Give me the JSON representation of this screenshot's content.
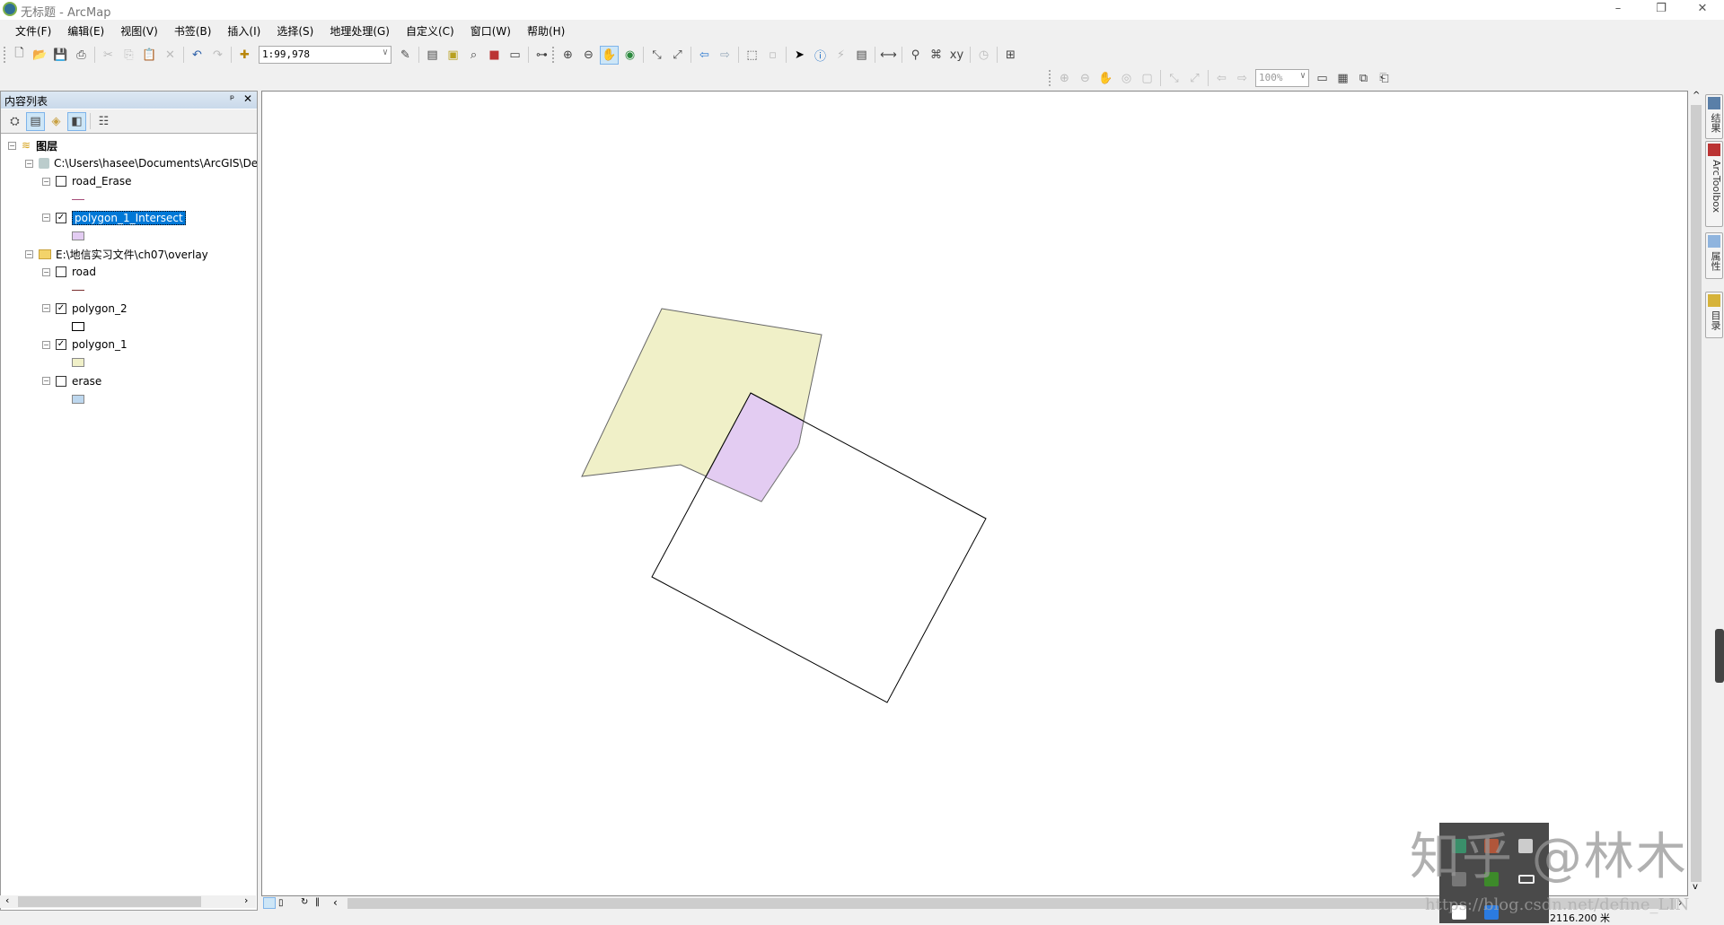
{
  "window": {
    "title": "无标题 - ArcMap",
    "minimize": "–",
    "restore": "❐",
    "close": "✕"
  },
  "menu": [
    "文件(F)",
    "编辑(E)",
    "视图(V)",
    "书签(B)",
    "插入(I)",
    "选择(S)",
    "地理处理(G)",
    "自定义(C)",
    "窗口(W)",
    "帮助(H)"
  ],
  "toolbar1": {
    "scale": "1:99,978",
    "group1": [
      "new-icon",
      "open-icon",
      "save-icon",
      "print-icon",
      "|",
      "cut-icon",
      "copy-icon",
      "paste-icon",
      "delete-icon",
      "|",
      "undo-icon",
      "redo-icon",
      "|",
      "add-data-icon"
    ],
    "group2": [
      "editor-icon",
      "|",
      "table-icon",
      "catalog-icon",
      "search-window-icon",
      "arctoolbox-icon",
      "python-icon",
      "|",
      "modelbuilder-icon",
      "grip",
      "zoom-in-icon",
      "zoom-out-icon",
      "pan-icon",
      "full-extent-icon",
      "|",
      "fixed-zoom-in-icon",
      "fixed-zoom-out-icon",
      "|",
      "back-icon",
      "forward-icon",
      "|",
      "select-features-icon",
      "clear-selection-icon",
      "|",
      "select-elements-icon",
      "identify-icon",
      "hyperlink-icon",
      "html-popup-icon",
      "|",
      "measure-icon",
      "|",
      "find-icon",
      "find-route-icon",
      "go-to-xy-icon",
      "|",
      "time-slider-icon",
      "|",
      "magnifier-icon"
    ]
  },
  "toolbar2": {
    "zoom": "100%",
    "icons": [
      "layout-zoom-in-icon",
      "layout-zoom-out-icon",
      "layout-pan-icon",
      "zoom-whole-page-icon",
      "zoom-100-icon",
      "|",
      "fixed-zoom-in-icon",
      "fixed-zoom-out-icon",
      "|",
      "back-extent-icon",
      "forward-extent-icon"
    ],
    "icons_after": [
      "toggle-draft-icon",
      "focus-frame-icon",
      "change-layout-icon",
      "data-driven-pages-icon"
    ]
  },
  "toc": {
    "title": "内容列表",
    "pin": "ᵖ",
    "close": "✕",
    "root": "图层",
    "groups": [
      {
        "label": "C:\\Users\\hasee\\Documents\\ArcGIS\\Default.gdb",
        "layers": [
          {
            "name": "road_Erase",
            "checked": false,
            "symbol": "line",
            "color": "#a64d79"
          },
          {
            "name": "polygon_1_Intersect",
            "checked": true,
            "selected": true,
            "symbol": "fill",
            "color": "#e3ccf2"
          }
        ]
      },
      {
        "label": "E:\\地信实习文件\\ch07\\overlay",
        "layers": [
          {
            "name": "road",
            "checked": false,
            "symbol": "line",
            "color": "#7a2e2e"
          },
          {
            "name": "polygon_2",
            "checked": true,
            "symbol": "fill",
            "color": "#ffffff"
          },
          {
            "name": "polygon_1",
            "checked": true,
            "symbol": "fill",
            "color": "#f0f0c8"
          },
          {
            "name": "erase",
            "checked": false,
            "symbol": "fill",
            "color": "#bdd7ee"
          }
        ]
      }
    ]
  },
  "dock": [
    "结果",
    "ArcToolbox",
    "属性",
    "目录"
  ],
  "status": {
    "coords": "2116.200 米"
  },
  "watermark": {
    "zhihu": "知乎 @林木",
    "csdn": "https://blog.csdn.net/define_LIN"
  },
  "colors": {
    "polygon_1": "#f0f0c8",
    "intersect": "#e3ccf2",
    "outline": "#555555",
    "selection": "#0078d7"
  }
}
